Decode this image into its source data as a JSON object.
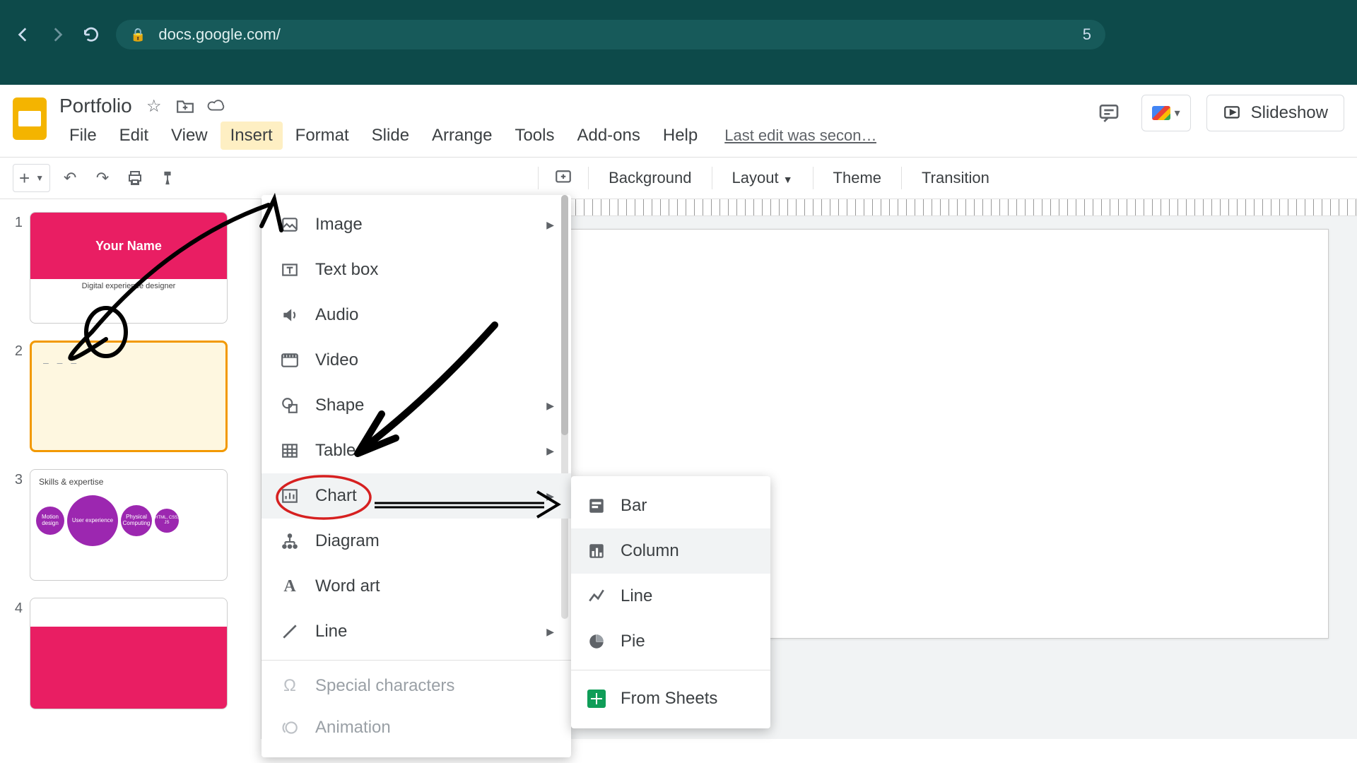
{
  "browser": {
    "url_host": "docs.google.com/",
    "right_badge": "5"
  },
  "header": {
    "doc_title": "Portfolio",
    "menus": [
      "File",
      "Edit",
      "View",
      "Insert",
      "Format",
      "Slide",
      "Arrange",
      "Tools",
      "Add-ons",
      "Help"
    ],
    "active_menu_index": 3,
    "last_edit": "Last edit was secon…",
    "slideshow_label": "Slideshow"
  },
  "toolbar": {
    "background_label": "Background",
    "layout_label": "Layout",
    "theme_label": "Theme",
    "transition_label": "Transition"
  },
  "thumbnails": [
    {
      "num": "1",
      "title": "Your Name",
      "subtitle": "Digital experience designer"
    },
    {
      "num": "2",
      "placeholder": "– – –"
    },
    {
      "num": "3",
      "title": "Skills & expertise",
      "circles": [
        "Motion design",
        "User experience",
        "Physical Computing",
        "HTML, CSS, JS"
      ]
    },
    {
      "num": "4"
    }
  ],
  "canvas": {
    "placeholder": "– – –"
  },
  "insert_menu": {
    "items": [
      {
        "label": "Image",
        "icon": "image-icon",
        "submenu": true
      },
      {
        "label": "Text box",
        "icon": "textbox-icon"
      },
      {
        "label": "Audio",
        "icon": "audio-icon"
      },
      {
        "label": "Video",
        "icon": "video-icon"
      },
      {
        "label": "Shape",
        "icon": "shape-icon",
        "submenu": true
      },
      {
        "label": "Table",
        "icon": "table-icon",
        "submenu": true
      },
      {
        "label": "Chart",
        "icon": "chart-icon",
        "submenu": true,
        "hovered": true
      },
      {
        "label": "Diagram",
        "icon": "diagram-icon"
      },
      {
        "label": "Word art",
        "icon": "wordart-icon"
      },
      {
        "label": "Line",
        "icon": "line-icon",
        "submenu": true
      },
      {
        "label": "Special characters",
        "icon": "special-icon",
        "disabled": true,
        "sep_before": true
      },
      {
        "label": "Animation",
        "icon": "animation-icon",
        "disabled": true
      }
    ]
  },
  "chart_submenu": {
    "items": [
      {
        "label": "Bar",
        "icon": "bar-chart-icon"
      },
      {
        "label": "Column",
        "icon": "column-chart-icon",
        "hovered": true
      },
      {
        "label": "Line",
        "icon": "line-chart-icon"
      },
      {
        "label": "Pie",
        "icon": "pie-chart-icon"
      }
    ],
    "from_sheets_label": "From Sheets"
  }
}
